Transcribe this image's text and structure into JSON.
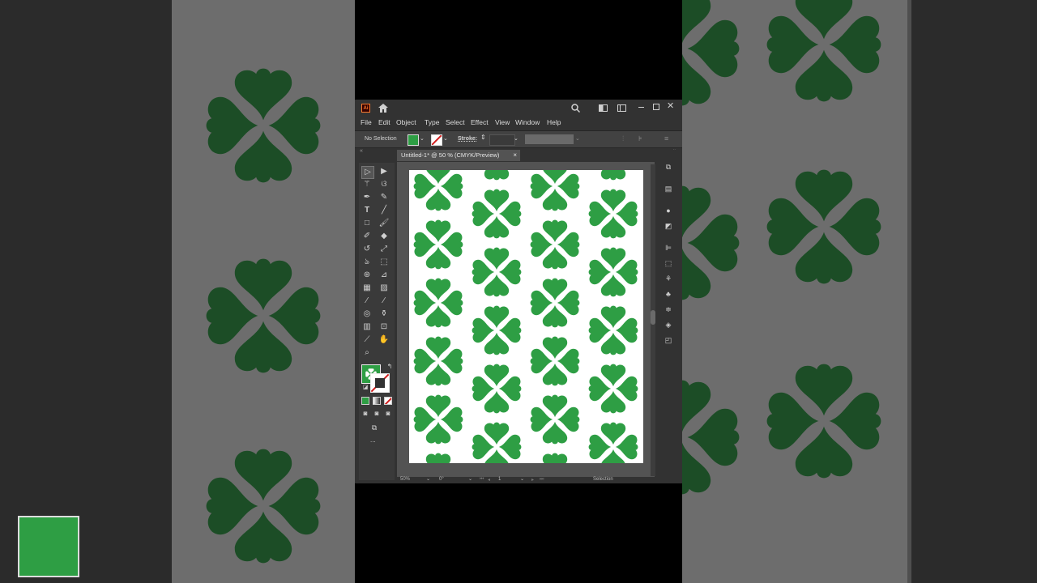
{
  "titlebar": {
    "app_icon": "Ai",
    "icons": [
      "home-icon",
      "search-icon",
      "arrange-documents-icon",
      "workspace-icon",
      "minimize-icon",
      "maximize-icon",
      "close-icon"
    ]
  },
  "menu": {
    "items": [
      "File",
      "Edit",
      "Object",
      "Type",
      "Select",
      "Effect",
      "View",
      "Window",
      "Help"
    ]
  },
  "control_bar": {
    "selection_status": "No Selection",
    "stroke_label": "Stroke:"
  },
  "document": {
    "tab_title": "Untitled-1* @ 50 % (CMYK/Preview)",
    "close_glyph": "×"
  },
  "status_bar": {
    "zoom": "50%",
    "rotation": "0°",
    "artboard_number": "1",
    "tool_name": "Selection"
  },
  "tools": {
    "more_glyph": "..."
  },
  "colors": {
    "clover_green": "#2e9e44",
    "clover_dark_green": "#1c4d26",
    "ui_background": "#323232",
    "canvas_gray": "#535353",
    "artboard": "#ffffff"
  }
}
